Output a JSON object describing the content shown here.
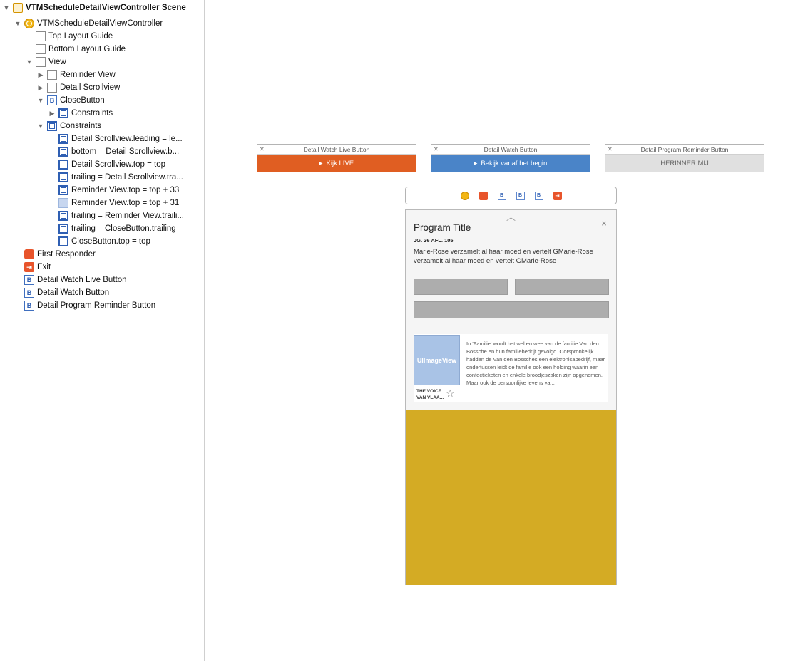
{
  "outline": {
    "scene_title": "VTMScheduleDetailViewController Scene",
    "controller": "VTMScheduleDetailViewController",
    "top_layout_guide": "Top Layout Guide",
    "bottom_layout_guide": "Bottom Layout Guide",
    "view": "View",
    "reminder_view": "Reminder View",
    "detail_scrollview": "Detail Scrollview",
    "close_button": "CloseButton",
    "constraints_sub": "Constraints",
    "constraints": "Constraints",
    "constraint_items": [
      "Detail Scrollview.leading = le...",
      "bottom = Detail Scrollview.b...",
      "Detail Scrollview.top = top",
      "trailing = Detail Scrollview.tra...",
      "Reminder View.top = top + 33",
      "Reminder View.top = top + 31",
      "trailing = Reminder View.traili...",
      "trailing = CloseButton.trailing",
      "CloseButton.top = top"
    ],
    "first_responder": "First Responder",
    "exit": "Exit",
    "btn_live": "Detail Watch Live Button",
    "btn_watch": "Detail Watch Button",
    "btn_reminder": "Detail Program Reminder Button"
  },
  "canvas": {
    "live_title": "Detail Watch Live Button",
    "live_label": "Kijk LIVE",
    "watch_title": "Detail Watch Button",
    "watch_label": "Bekijk vanaf het begin",
    "reminder_title": "Detail Program Reminder Button",
    "reminder_label": "HERINNER MIJ",
    "close_x": "×",
    "program_title": "Program Title",
    "meta": "JG. 26 AFL. 105",
    "description": "Marie-Rose verzamelt al haar moed en vertelt GMarie-Rose verzamelt al haar moed en vertelt GMarie-Rose",
    "thumb_label": "UIImageView",
    "card_name": "THE VOICE VAN VLAA...",
    "card_text": "In 'Familie' wordt het wel en wee van de familie Van den Bossche en hun familiebedrijf gevolgd. Oorspronkelijk hadden de Van den Bossches een elektronicabedrijf, maar ondertussen leidt de familie ook een holding waarin een confectieketen en enkele broodjeszaken zijn opgenomen. Maar ook de persoonlijke levens va...",
    "colors": {
      "live": "#e05e22",
      "watch": "#4a84c8",
      "reminder": "#e0e0e0",
      "gold": "#d4ab24"
    }
  }
}
